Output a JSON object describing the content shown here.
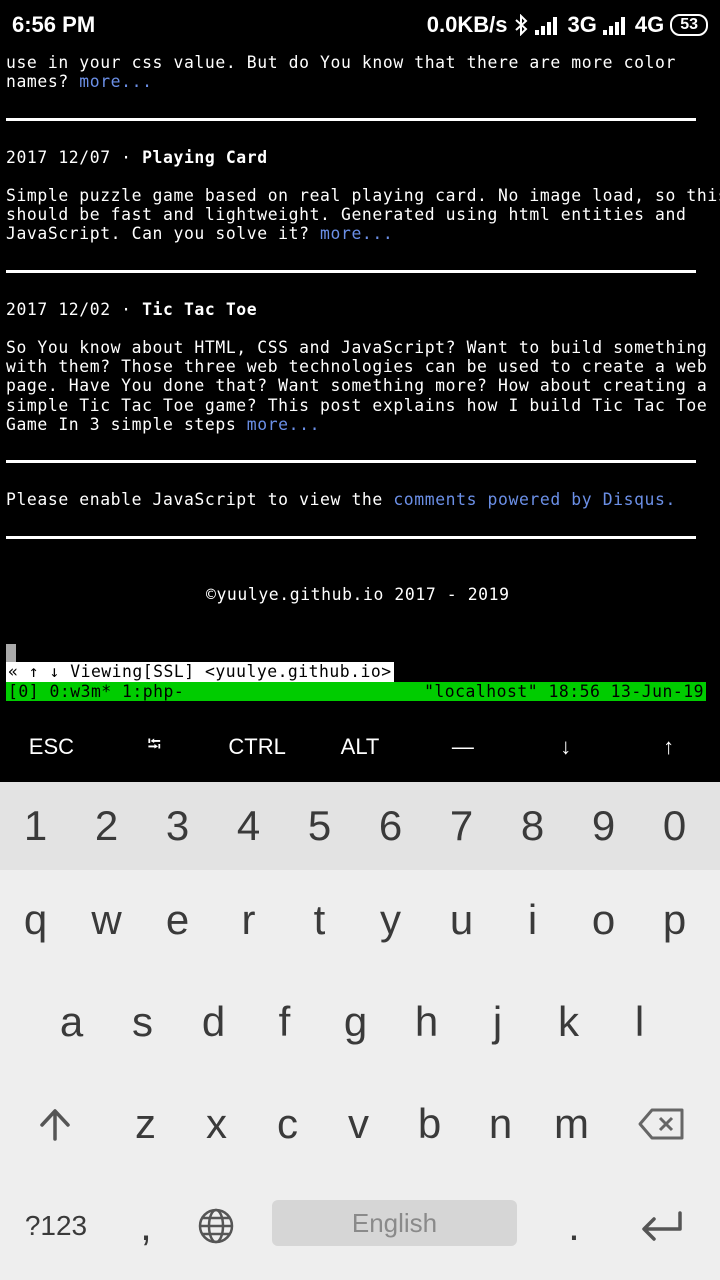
{
  "statusbar": {
    "time": "6:56 PM",
    "speed": "0.0KB/s",
    "net1": "3G",
    "net2": "4G",
    "battery": "53"
  },
  "content": {
    "para0": "use in your css value. But do You know that there are more color\nnames? ",
    "para0_more": "more...",
    "post1_date": "2017 12/07 · ",
    "post1_title": "Playing Card",
    "post1_body": "Simple puzzle game based on real playing card. No image load, so this\nshould be fast and lightweight. Generated using html entities and\nJavaScript. Can you solve it? ",
    "post1_more": "more...",
    "post2_date": "2017 12/02 · ",
    "post2_title": "Tic Tac Toe",
    "post2_body": "So You know about HTML, CSS and JavaScript? Want to build something\nwith them? Those three web technologies can be used to create a web\npage. Have You done that? Want something more? How about creating a\nsimple Tic Tac Toe game? This post explains how I build Tic Tac Toe\nGame In 3 simple steps ",
    "post2_more": "more...",
    "disqus_text": "Please enable JavaScript to view the ",
    "disqus_link": "comments powered by Disqus.",
    "footer": "©yuulye.github.io 2017 - 2019"
  },
  "w3m_status": "« ↑ ↓ Viewing[SSL] <yuulye.github.io>",
  "tmux": {
    "left": "[0] 0:w3m* 1:php-",
    "right": "\"localhost\" 18:56 13-Jun-19"
  },
  "extra_keys": [
    "ESC",
    "⭾",
    "CTRL",
    "ALT",
    "—",
    "↓",
    "↑"
  ],
  "keyboard": {
    "numbers": [
      "1",
      "2",
      "3",
      "4",
      "5",
      "6",
      "7",
      "8",
      "9",
      "0"
    ],
    "row1": [
      "q",
      "w",
      "e",
      "r",
      "t",
      "y",
      "u",
      "i",
      "o",
      "p"
    ],
    "row2": [
      "a",
      "s",
      "d",
      "f",
      "g",
      "h",
      "j",
      "k",
      "l"
    ],
    "row3": [
      "z",
      "x",
      "c",
      "v",
      "b",
      "n",
      "m"
    ],
    "symbols_label": "?123",
    "comma": ",",
    "space_label": "English",
    "period": "."
  },
  "colors": {
    "link": "#6b8fe6",
    "tmux_bg": "#00cc00"
  }
}
